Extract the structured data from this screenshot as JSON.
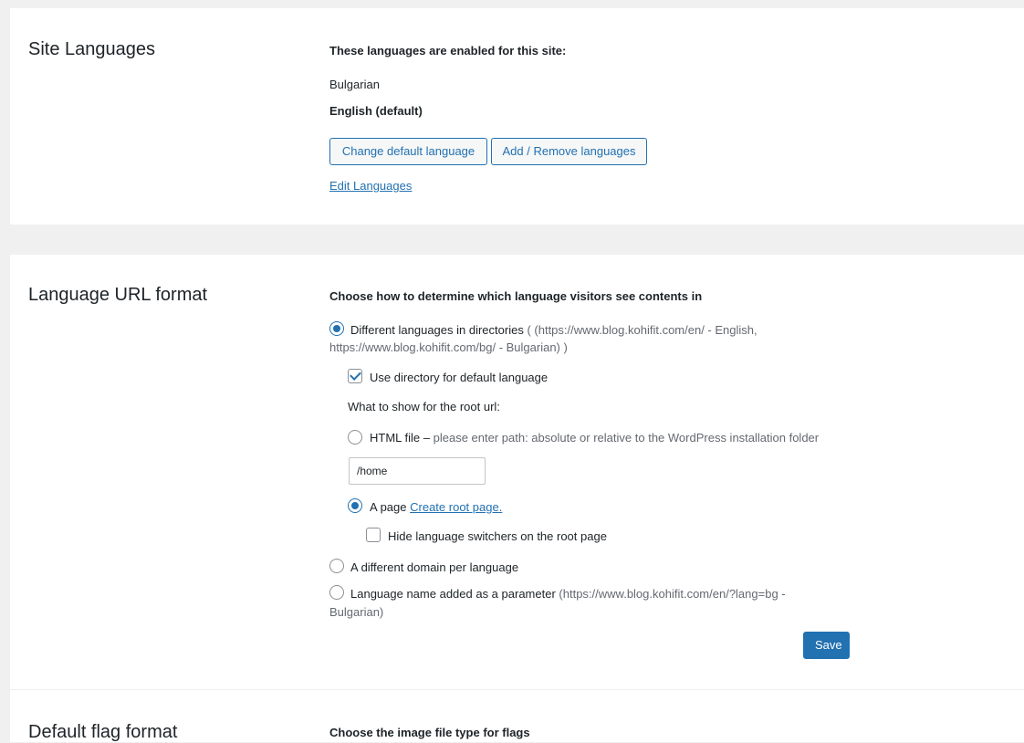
{
  "site_languages": {
    "title": "Site Languages",
    "enabled_heading": "These languages are enabled for this site:",
    "languages": [
      "Bulgarian",
      "English (default)"
    ],
    "change_default_button": "Change default language",
    "add_remove_button": "Add / Remove languages",
    "edit_link": "Edit Languages"
  },
  "url_format": {
    "title": "Language URL format",
    "heading": "Choose how to determine which language visitors see contents in",
    "option_directories": {
      "label": "Different languages in directories",
      "hint_line1": "( (https://www.blog.kohifit.com/en/ - English,",
      "hint_line2": "https://www.blog.kohifit.com/bg/ - Bulgarian) )",
      "selected": true
    },
    "use_directory_default": {
      "label": "Use directory for default language",
      "checked": true
    },
    "root_url_label": "What to show for the root url:",
    "html_file": {
      "label": "HTML file –",
      "hint": "please enter path: absolute or relative to the WordPress installation folder",
      "value": "/home",
      "selected": false
    },
    "a_page": {
      "label": "A page",
      "link": "Create root page.",
      "selected": true
    },
    "hide_switchers": {
      "label": "Hide language switchers on the root page",
      "checked": false
    },
    "option_domain": {
      "label": "A different domain per language",
      "selected": false
    },
    "option_parameter": {
      "label": "Language name added as a parameter",
      "hint_line1": "(https://www.blog.kohifit.com/en/?lang=bg -",
      "hint_line2": "Bulgarian)",
      "selected": false
    },
    "save_button": "Save"
  },
  "flag_format": {
    "title": "Default flag format",
    "heading": "Choose the image file type for flags"
  },
  "colors": {
    "accent": "#2271b1",
    "background": "#f0f0f1",
    "panel": "#ffffff"
  }
}
